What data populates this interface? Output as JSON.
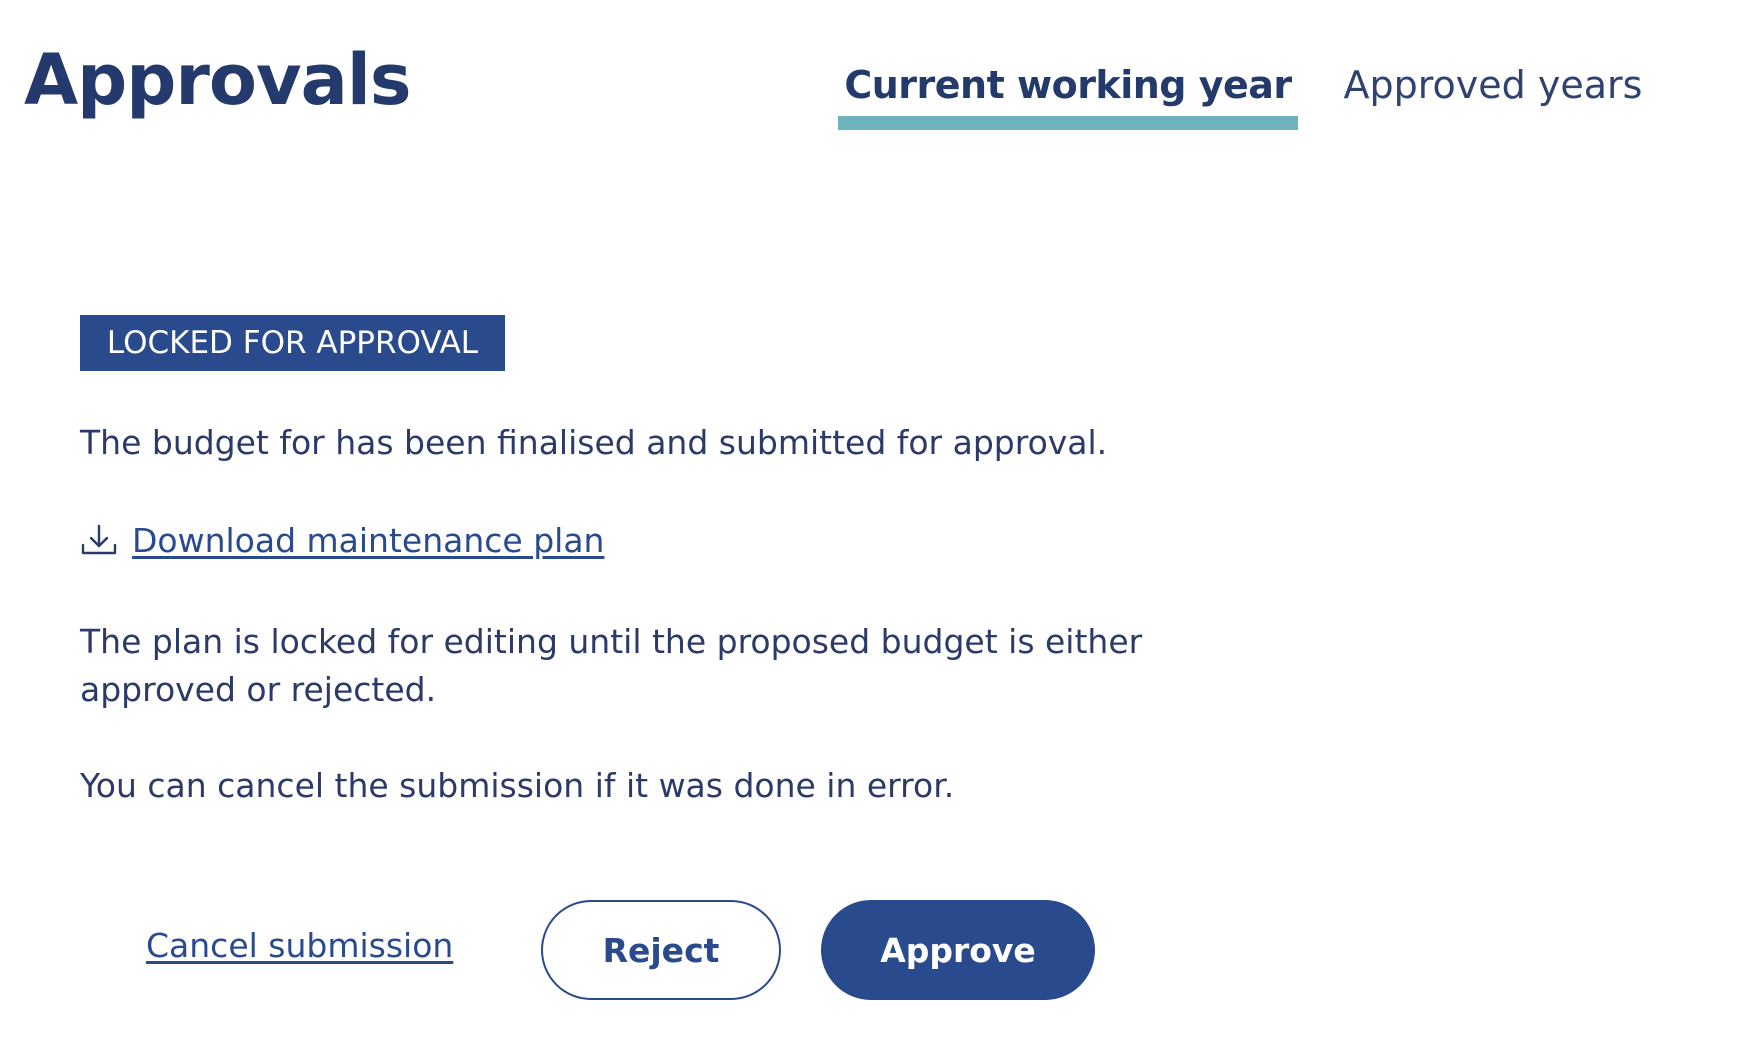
{
  "page": {
    "title": "Approvals"
  },
  "tabs": [
    {
      "label": "Current working year",
      "active": true
    },
    {
      "label": "Approved years",
      "active": false
    }
  ],
  "status": {
    "badge": "LOCKED FOR APPROVAL"
  },
  "content": {
    "submitted_message": "The budget for has been finalised and submitted for approval.",
    "download_label": "Download maintenance plan",
    "download_icon": "download-icon",
    "locked_message": "The plan is locked for editing until the proposed budget is either approved or rejected.",
    "cancel_hint": "You can cancel the submission if it was done in error."
  },
  "actions": {
    "cancel_label": "Cancel submission",
    "reject_label": "Reject",
    "approve_label": "Approve"
  },
  "colors": {
    "primary": "#2a4a8e",
    "text": "#2b3a68",
    "tab_accent": "#6db2bc"
  }
}
